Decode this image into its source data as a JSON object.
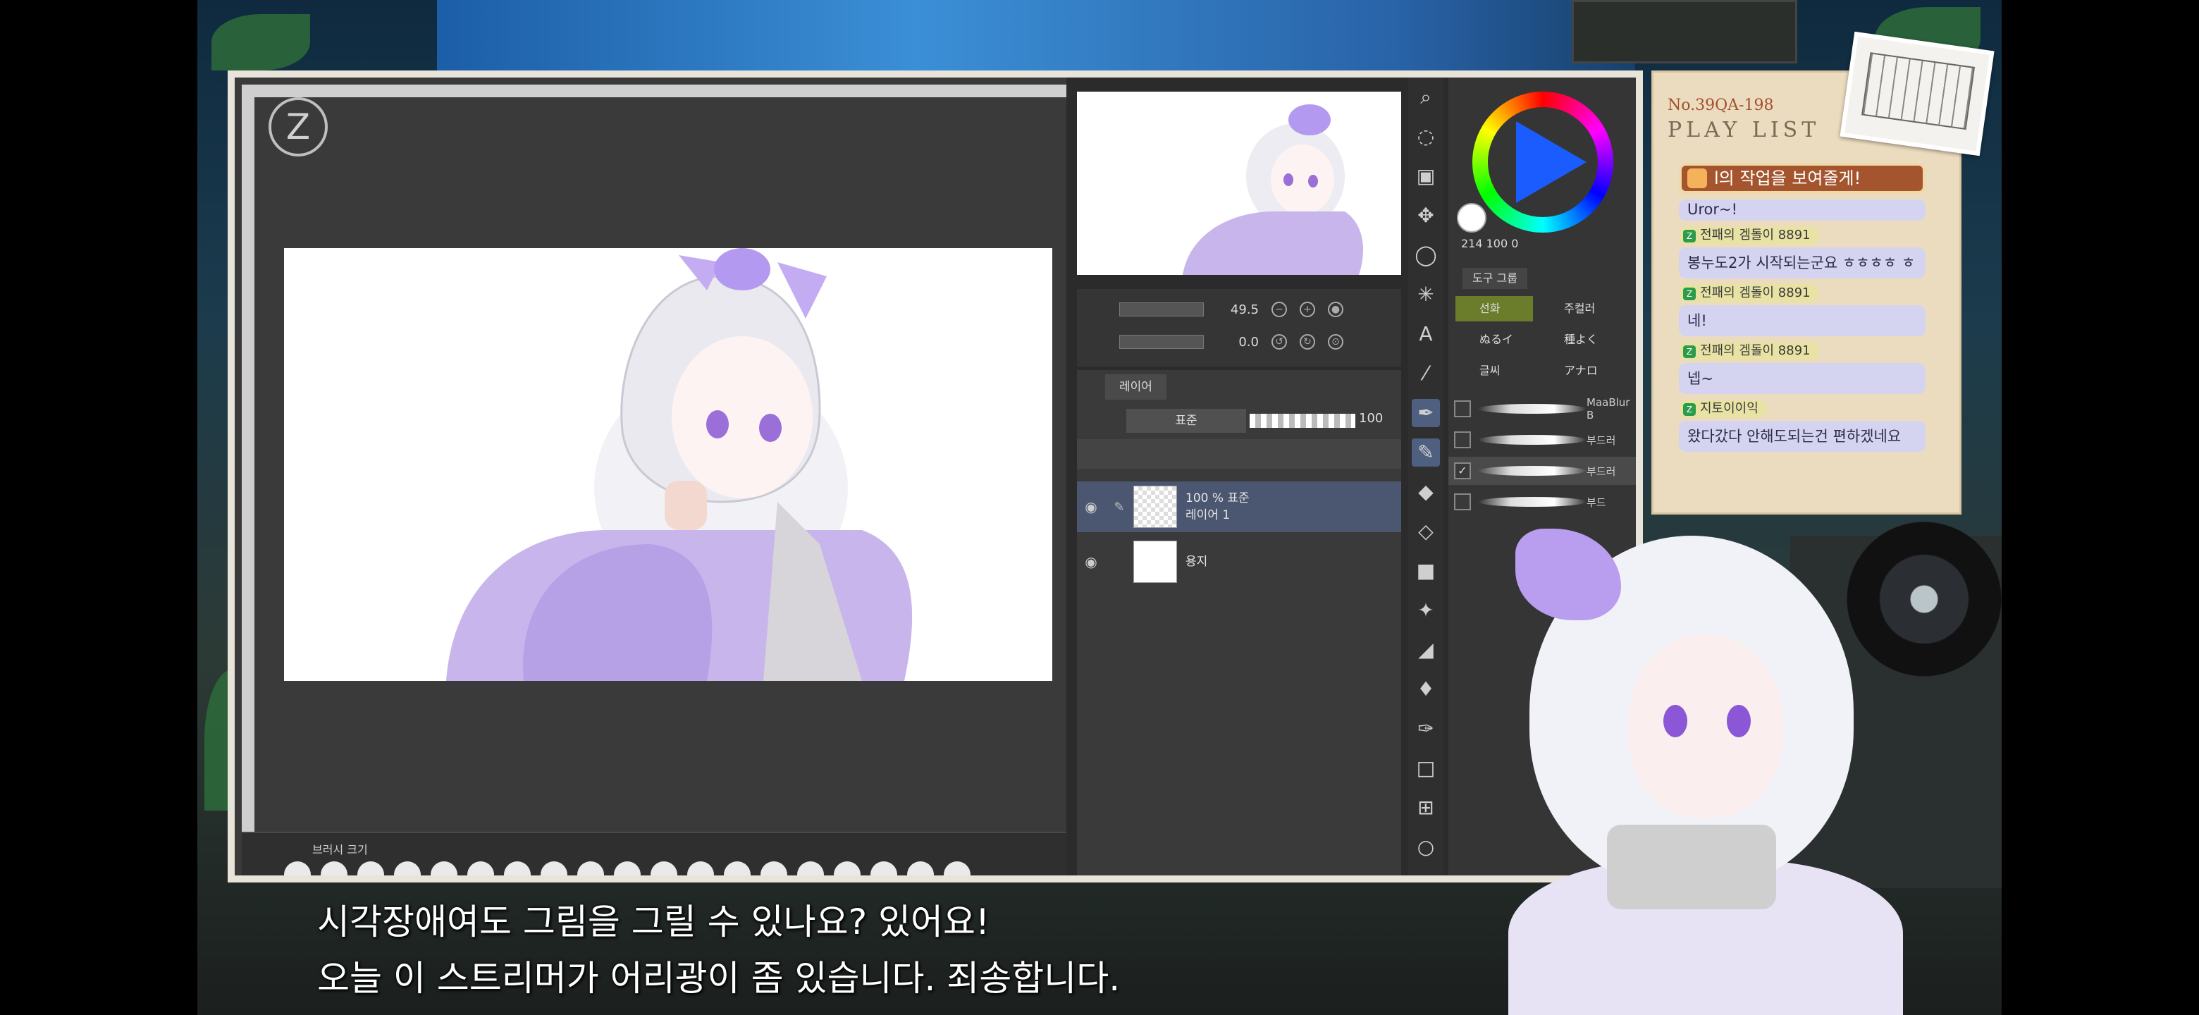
{
  "canvas": {
    "brush_size_label": "브러시 크기",
    "logo_glyph": "Z"
  },
  "nav": {
    "zoom_value": "49.5",
    "rotate_value": "0.0"
  },
  "layers": {
    "tab_label": "레이어",
    "blend_mode": "표준",
    "opacity": "100",
    "items": [
      {
        "line1": "100 % 표준",
        "line2": "레이어 1",
        "active": true
      },
      {
        "line1": "",
        "line2": "용지",
        "active": false
      }
    ]
  },
  "color": {
    "hsv_readout": "214  100  0"
  },
  "tool_group": {
    "tab_label": "도구 그룹",
    "items": [
      "선화",
      "주컬러",
      "ぬるイ",
      "種よく",
      "글씨",
      "アナロ"
    ]
  },
  "brushes": [
    {
      "name": "MaaBlur B",
      "checked": false
    },
    {
      "name": "부드러",
      "checked": false
    },
    {
      "name": "부드러",
      "checked": true
    },
    {
      "name": "부드",
      "checked": false
    }
  ],
  "playlist": {
    "number_text": "No.39QA-198",
    "title": "PLAY LIST",
    "header": "l의 작업을 보여줄게!",
    "messages": [
      {
        "user": "",
        "text": "Uror~!"
      },
      {
        "user": "전패의 겜돌이 8891",
        "text": "봉누도2가 시작되는군요 ㅎㅎㅎㅎ ㅎ"
      },
      {
        "user": "전패의 겜돌이 8891",
        "text": "네!"
      },
      {
        "user": "전패의 겜돌이 8891",
        "text": "넵~"
      },
      {
        "user": "지토이이익",
        "text": "왔다갔다 안해도되는건 편하겠네요"
      }
    ]
  },
  "subtitles": {
    "line1": "시각장애여도 그림을 그릴 수 있나요? 있어요!",
    "line2": "오늘 이 스트리머가 어리광이 좀 있습니다. 죄송합니다."
  }
}
